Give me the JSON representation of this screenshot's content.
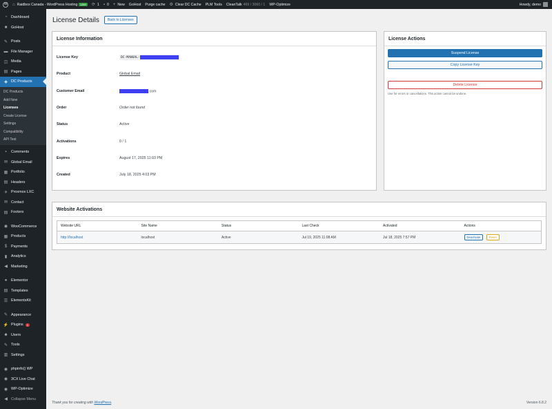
{
  "admin_bar": {
    "site_name": "Raidbox Canada - WordPress Hosting",
    "live_badge": "Live",
    "updates_count": "1",
    "comments_count": "0",
    "new_label": "New",
    "items": [
      "GoHost",
      "Purge cache",
      "Clear DC Cache",
      "PLM Tools"
    ],
    "cleantalk_label": "CleanTalk",
    "cleantalk_stats": "469 / 3060 / 1",
    "wp_optimize": "WP-Optimize",
    "howdy": "Howdy, demo"
  },
  "sidebar": {
    "dashboard": "Dashboard",
    "gohost": "GoHost",
    "posts": "Posts",
    "file_manager": "File Manager",
    "media": "Media",
    "pages": "Pages",
    "dc_products": "DC Products",
    "submenu": [
      "DC Products",
      "Add New",
      "Licenses",
      "Create License",
      "Settings",
      "Compatibility",
      "API Test"
    ],
    "comments": "Comments",
    "global_email": "Global Email",
    "portfolio": "Portfolio",
    "headers": "Headers",
    "proxmox": "Proxmox LXC",
    "contact": "Contact",
    "footers": "Footers",
    "woocommerce": "WooCommerce",
    "products": "Products",
    "payments": "Payments",
    "analytics": "Analytics",
    "marketing": "Marketing",
    "elementor": "Elementor",
    "templates": "Templates",
    "elementskit": "ElementsKit",
    "appearance": "Appearance",
    "plugins": "Plugins",
    "plugins_badge": "1",
    "users": "Users",
    "tools": "Tools",
    "settings": "Settings",
    "phpinfo": "phpinfo() WP",
    "livechat": "3CX Live Chat",
    "wpoptimize": "WP-Optimize",
    "collapse": "Collapse Menu"
  },
  "page": {
    "title": "License Details",
    "back_button": "Back to Licenses"
  },
  "license_info": {
    "heading": "License Information",
    "rows": {
      "key_label": "License Key",
      "key_value": "DC-MANUAL-",
      "product_label": "Product",
      "product_value": "Global Email",
      "email_label": "Customer Email",
      "email_suffix": ".com",
      "order_label": "Order",
      "order_value": "Order not found",
      "status_label": "Status",
      "status_value": "Active",
      "activations_label": "Activations",
      "activations_value": "0 / 1",
      "expires_label": "Expires",
      "expires_value": "August 17, 2025 11:03 PM",
      "created_label": "Created",
      "created_value": "July 18, 2025 4:03 PM"
    }
  },
  "license_actions": {
    "heading": "License Actions",
    "suspend": "Suspend License",
    "copy": "Copy License Key",
    "delete": "Delete License",
    "note": "Use for errors or cancellations. This action cannot be undone."
  },
  "website_activations": {
    "heading": "Website Activations",
    "columns": [
      "Website URL",
      "Site Name",
      "Status",
      "Last Check",
      "Activated",
      "Actions"
    ],
    "row": {
      "url": "http://localhost",
      "site_name": "localhost",
      "status": "Active",
      "last_check": "Jul 19, 2025 11:08 AM",
      "activated": "Jul 18, 2025 7:57 PM",
      "deactivate": "Deactivate",
      "reset": "Reset"
    }
  },
  "footer": {
    "thanks_prefix": "Thank you for creating with",
    "wordpress": "WordPress",
    "period": ".",
    "version": "Version 6.8.2"
  },
  "colors": {
    "admin_bg": "#1d2327",
    "accent": "#2271b1",
    "danger": "#d63638",
    "redaction": "#3f3ff2"
  }
}
